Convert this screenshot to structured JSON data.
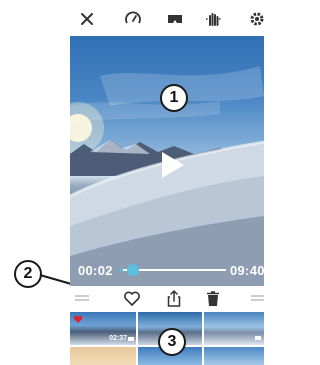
{
  "toolbar": {
    "icons": [
      "close-icon",
      "speedometer-icon",
      "vr-goggles-icon",
      "hand-stabilize-icon",
      "gear-icon"
    ]
  },
  "player": {
    "current_time": "00:02",
    "duration": "09:40",
    "progress": 0.03
  },
  "actions": {
    "icons": [
      "menu-lines-icon",
      "heart-icon",
      "share-icon",
      "trash-icon",
      "menu-lines-icon"
    ]
  },
  "thumbnails": {
    "selected_duration": "02:37"
  },
  "callouts": {
    "one": "1",
    "two": "2",
    "three": "3"
  },
  "colors": {
    "progress_accent": "#5bc0de",
    "favorite_marker": "#d9262c"
  }
}
